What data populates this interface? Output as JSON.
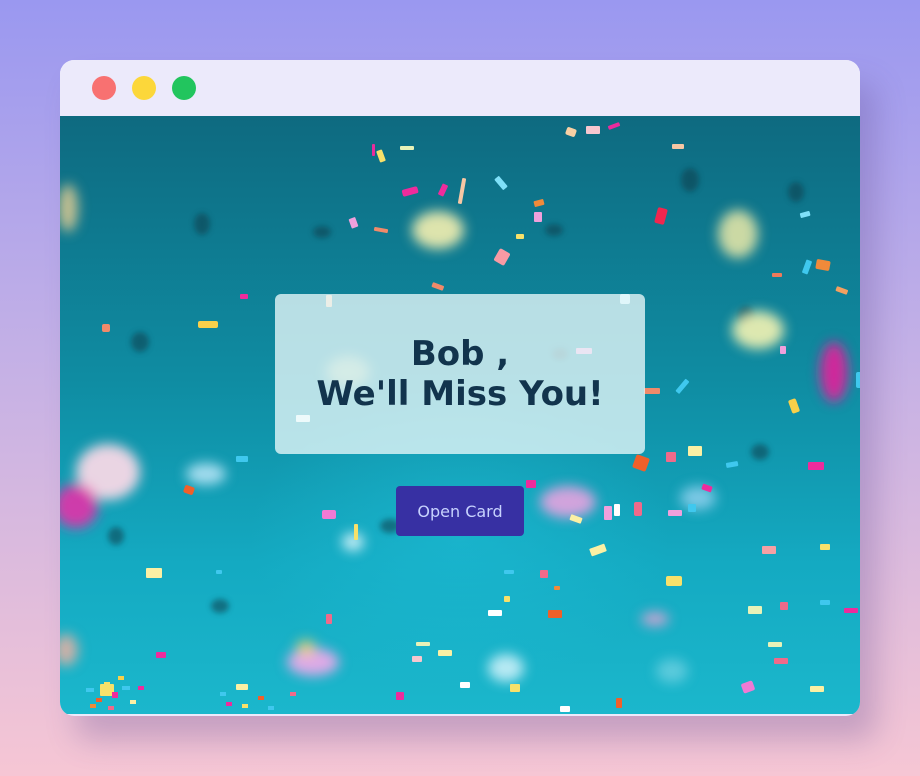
{
  "card": {
    "line1": "Bob ,",
    "line2": "We'll Miss You!"
  },
  "open_button": {
    "label": "Open Card"
  },
  "window_controls": [
    "close-dot",
    "minimize-dot",
    "maximize-dot"
  ],
  "colors": {
    "accent_button": "#3730a3",
    "heading_text": "#12344d",
    "titlebar": "#eceafb"
  }
}
